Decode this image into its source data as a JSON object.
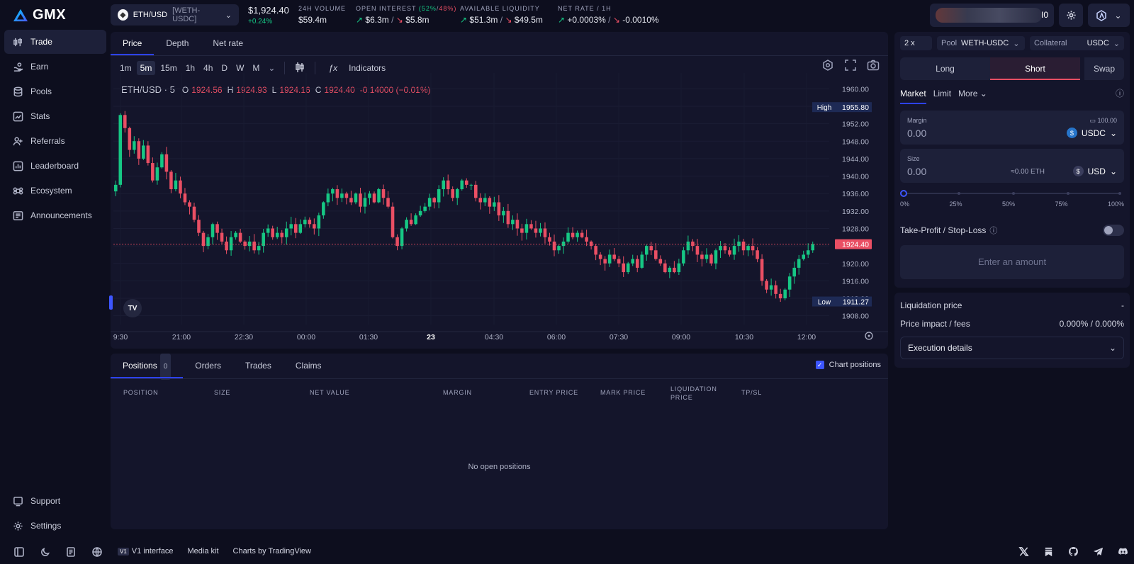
{
  "app": {
    "logo": "GMX"
  },
  "sidebar": {
    "items": [
      {
        "label": "Trade",
        "icon": "trade-icon",
        "active": true
      },
      {
        "label": "Earn",
        "icon": "earn-icon"
      },
      {
        "label": "Pools",
        "icon": "pools-icon"
      },
      {
        "label": "Stats",
        "icon": "stats-icon"
      },
      {
        "label": "Referrals",
        "icon": "referrals-icon"
      },
      {
        "label": "Leaderboard",
        "icon": "leaderboard-icon"
      },
      {
        "label": "Ecosystem",
        "icon": "ecosystem-icon"
      },
      {
        "label": "Announcements",
        "icon": "announcements-icon"
      }
    ],
    "bottom": [
      {
        "label": "Support",
        "icon": "support-icon"
      },
      {
        "label": "Settings",
        "icon": "settings-icon"
      }
    ]
  },
  "topbar": {
    "market": "ETH/USD",
    "pool": "[WETH-USDC]",
    "price": "$1,924.40",
    "change": "+0.24%",
    "volume_label": "24H VOLUME",
    "volume": "$59.4m",
    "oi_label": "OPEN INTEREST",
    "oi_long_pct": "(52%",
    "oi_short_pct": "48%)",
    "oi_long": "$6.3m",
    "oi_short": "$5.8m",
    "liq_label": "AVAILABLE LIQUIDITY",
    "liq_long": "$51.3m",
    "liq_short": "$49.5m",
    "rate_label": "NET RATE / 1H",
    "rate_long": "+0.0003%",
    "rate_short": "-0.0010%",
    "wallet_tail": "I0"
  },
  "chart_tabs": [
    "Price",
    "Depth",
    "Net rate"
  ],
  "timeframes": [
    "1m",
    "5m",
    "15m",
    "1h",
    "4h",
    "D",
    "W",
    "M"
  ],
  "active_timeframe": "5m",
  "indicators_label": "Indicators",
  "ohlc": {
    "symbol": "ETH/USD · 5",
    "o_label": "O",
    "o": "1924.56",
    "h_label": "H",
    "h": "1924.93",
    "l_label": "L",
    "l": "1924.16",
    "c_label": "C",
    "c": "1924.40",
    "chg": "-0.14000 (−0.01%)"
  },
  "chart_data": {
    "type": "candlestick",
    "x_ticks": [
      "9:30",
      "21:00",
      "22:30",
      "00:00",
      "01:30",
      "23",
      "04:30",
      "06:00",
      "07:30",
      "09:00",
      "10:30",
      "12:00"
    ],
    "y_ticks": [
      "1960.00",
      "1956.00",
      "1952.00",
      "1948.00",
      "1944.00",
      "1940.00",
      "1936.00",
      "1932.00",
      "1928.00",
      "1924.00",
      "1920.00",
      "1916.00",
      "1912.00",
      "1908.00"
    ],
    "ylim": [
      1906,
      1962
    ],
    "high_label": "High",
    "high": "1955.80",
    "low_label": "Low",
    "low": "1911.27",
    "last": "1924.40",
    "up_color": "#16c784",
    "down_color": "#ea4f64",
    "close_path": [
      1938,
      1954,
      1951,
      1946,
      1948,
      1944,
      1947,
      1943,
      1939,
      1942,
      1945,
      1941,
      1937,
      1939,
      1936,
      1934,
      1933,
      1930,
      1927,
      1924,
      1926,
      1929,
      1927,
      1925,
      1923,
      1926,
      1927,
      1925,
      1924,
      1925,
      1923,
      1924,
      1927,
      1928,
      1926,
      1927,
      1926,
      1928,
      1929,
      1927,
      1929,
      1930,
      1929,
      1928,
      1931,
      1934,
      1936,
      1937,
      1935,
      1936,
      1935,
      1934,
      1936,
      1933,
      1935,
      1936,
      1934,
      1937,
      1935,
      1933,
      1926,
      1924,
      1928,
      1930,
      1929,
      1931,
      1932,
      1933,
      1935,
      1934,
      1937,
      1939,
      1937,
      1935,
      1937,
      1939,
      1938,
      1938,
      1935,
      1934,
      1935,
      1933,
      1934,
      1931,
      1932,
      1929,
      1930,
      1928,
      1927,
      1929,
      1928,
      1927,
      1928,
      1926,
      1925,
      1923,
      1924,
      1925,
      1927,
      1926,
      1927,
      1926,
      1925,
      1924,
      1922,
      1921,
      1920,
      1922,
      1921,
      1920,
      1918,
      1920,
      1921,
      1919,
      1922,
      1924,
      1923,
      1921,
      1920,
      1918,
      1919,
      1918,
      1920,
      1923,
      1925,
      1924,
      1922,
      1921,
      1922,
      1920,
      1923,
      1924,
      1923,
      1922,
      1924,
      1925,
      1923,
      1924,
      1923,
      1921,
      1916,
      1914,
      1915,
      1913,
      1912,
      1914,
      1917,
      1919,
      1921,
      1922,
      1923,
      1924.4
    ]
  },
  "positions": {
    "tabs": [
      {
        "label": "Positions",
        "count": "0"
      },
      {
        "label": "Orders"
      },
      {
        "label": "Trades"
      },
      {
        "label": "Claims"
      }
    ],
    "chart_positions": "Chart positions",
    "columns": [
      "POSITION",
      "SIZE",
      "NET VALUE",
      "MARGIN",
      "ENTRY PRICE",
      "MARK PRICE",
      "LIQUIDATION PRICE",
      "TP/SL"
    ],
    "empty": "No open positions"
  },
  "trade": {
    "leverage": "2 x",
    "pool_label": "Pool",
    "pool": "WETH-USDC",
    "collateral_label": "Collateral",
    "collateral": "USDC",
    "sides": [
      "Long",
      "Short",
      "Swap"
    ],
    "active_side": "Short",
    "order_types": [
      "Market",
      "Limit",
      "More"
    ],
    "margin_label": "Margin",
    "margin_value": "0.00",
    "margin_balance": "100.00",
    "margin_token": "USDC",
    "size_label": "Size",
    "size_value": "0.00",
    "size_approx": "≈0.00 ETH",
    "size_token": "USD",
    "slider_marks": [
      "0%",
      "25%",
      "50%",
      "75%",
      "100%"
    ],
    "slider_value": 0,
    "tpsl_label": "Take-Profit / Stop-Loss",
    "submit": "Enter an amount"
  },
  "info": {
    "liq_label": "Liquidation price",
    "liq_value": "-",
    "impact_label": "Price impact / fees",
    "impact_value": "0.000% / 0.000%",
    "exec_label": "Execution details"
  },
  "footer": {
    "v1_badge": "V1",
    "v1_label": "V1 interface",
    "media": "Media kit",
    "charts_by": "Charts by TradingView"
  }
}
